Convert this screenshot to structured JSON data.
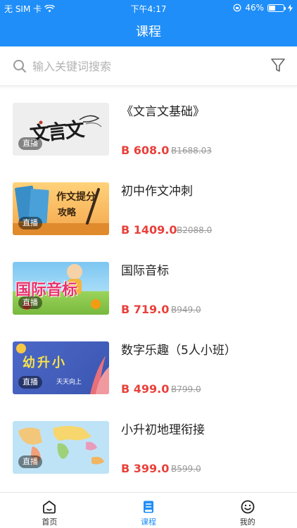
{
  "status": {
    "carrier": "无 SIM 卡",
    "time": "下午4:17",
    "battery": "46%",
    "battery_level": 0.46
  },
  "header": {
    "title": "课程"
  },
  "search": {
    "placeholder": "输入关键词搜索"
  },
  "courses": [
    {
      "title": "《文言文基础》",
      "price": "B 608.0",
      "original": "B1688.03",
      "badge": "直播"
    },
    {
      "title": "初中作文冲刺",
      "price": "B 1409.0",
      "original": "B2088.0",
      "badge": "直播"
    },
    {
      "title": "国际音标",
      "price": "B 719.0",
      "original": "B949.0",
      "badge": "直播"
    },
    {
      "title": "数字乐趣（5人小班）",
      "price": "B 499.0",
      "original": "B799.0",
      "badge": "直播"
    },
    {
      "title": "小升初地理衔接",
      "price": "B 399.0",
      "original": "B599.0",
      "badge": "直播"
    }
  ],
  "thumb_text": {
    "c0": "文言文",
    "c1a": "作文提分",
    "c1b": "攻略",
    "c2": "国际音标",
    "c3a": "幼升小",
    "c3b": "天天向上"
  },
  "tabs": [
    {
      "label": "首页",
      "icon": "home-icon"
    },
    {
      "label": "课程",
      "icon": "course-book-icon"
    },
    {
      "label": "我的",
      "icon": "smiley-icon"
    }
  ],
  "colors": {
    "primary": "#1f8ef8",
    "price": "#e8413b"
  }
}
